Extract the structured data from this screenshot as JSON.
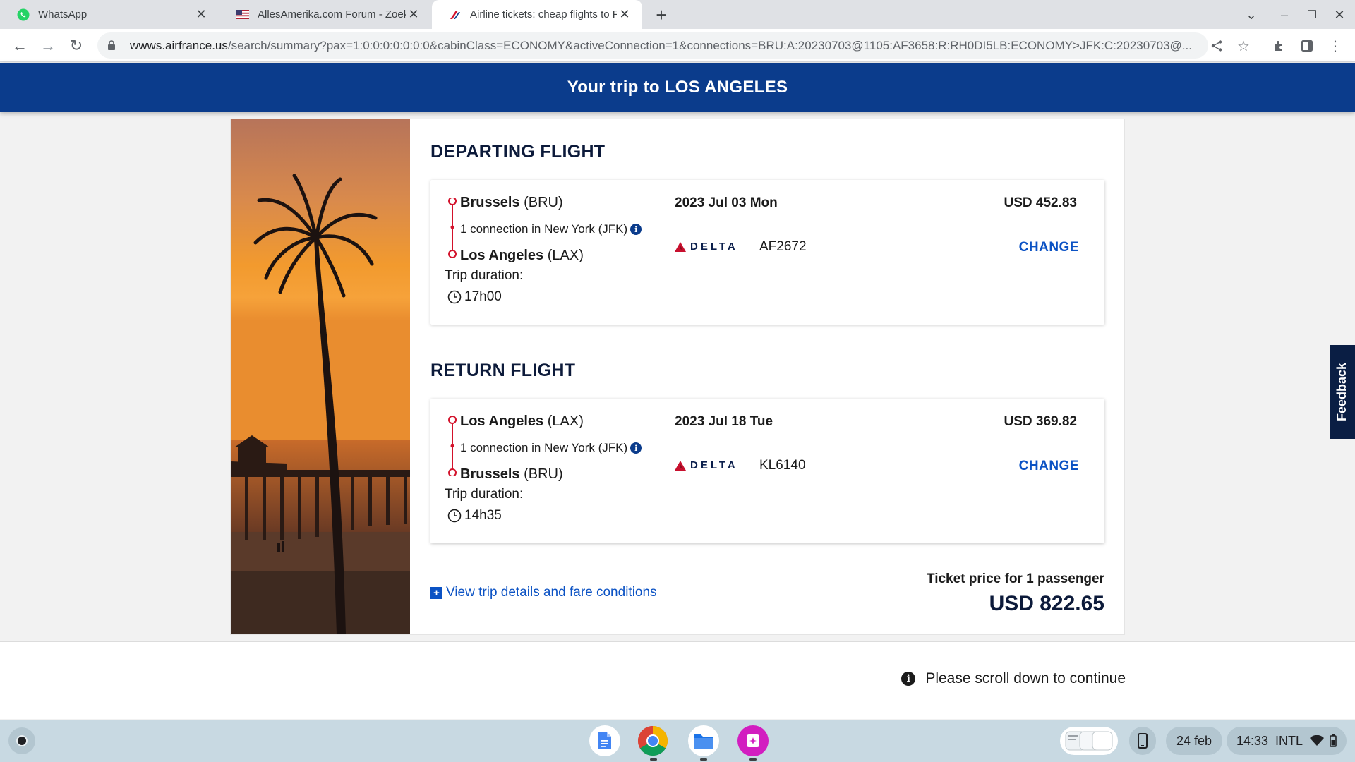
{
  "browser": {
    "tabs": [
      {
        "label": "WhatsApp",
        "icon": "whatsapp-icon",
        "active": false
      },
      {
        "label": "AllesAmerika.com Forum - Zoek",
        "icon": "us-flag-icon",
        "active": false
      },
      {
        "label": "Airline tickets: cheap flights to Fr",
        "icon": "airfrance-icon",
        "active": true
      }
    ],
    "url_domain": "wwws.airfrance.us",
    "url_path": "/search/summary?pax=1:0:0:0:0:0:0:0&cabinClass=ECONOMY&activeConnection=1&connections=BRU:A:20230703@1105:AF3658:R:RH0DI5LB:ECONOMY>JFK:C:20230703@..."
  },
  "header": {
    "title": "Your trip to LOS ANGELES"
  },
  "departing": {
    "section_title": "DEPARTING FLIGHT",
    "from_city": "Brussels",
    "from_code": "(BRU)",
    "connection": "1 connection in New York (JFK)",
    "to_city": "Los Angeles",
    "to_code": "(LAX)",
    "duration_label": "Trip duration:",
    "duration": "17h00",
    "date": "2023 Jul 03 Mon",
    "airline": "DELTA",
    "flight_number": "AF2672",
    "price": "USD 452.83",
    "change_label": "CHANGE"
  },
  "return": {
    "section_title": "RETURN FLIGHT",
    "from_city": "Los Angeles",
    "from_code": "(LAX)",
    "connection": "1 connection in New York (JFK)",
    "to_city": "Brussels",
    "to_code": "(BRU)",
    "duration_label": "Trip duration:",
    "duration": "14h35",
    "date": "2023 Jul 18 Tue",
    "airline": "DELTA",
    "flight_number": "KL6140",
    "price": "USD 369.82",
    "change_label": "CHANGE"
  },
  "summary": {
    "details_link": "View trip details and fare conditions",
    "ticket_label": "Ticket price for 1 passenger",
    "total": "USD 822.65"
  },
  "notice": "Please scroll down to continue",
  "feedback_label": "Feedback",
  "shelf": {
    "date": "24 feb",
    "time": "14:33",
    "input": "INTL",
    "apps": [
      "docs-icon",
      "chrome-icon",
      "files-icon",
      "gallery-icon"
    ]
  },
  "colors": {
    "brand_blue": "#0b3c8c",
    "link_blue": "#0b52c4",
    "route_red": "#d3122b"
  }
}
